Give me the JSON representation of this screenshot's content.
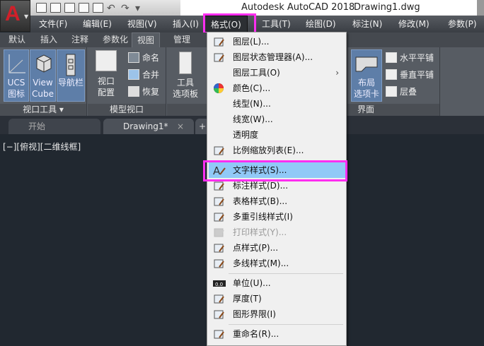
{
  "app": {
    "logo_letter": "A",
    "title": "Autodesk AutoCAD 2018",
    "document": "Drawing1.dwg"
  },
  "quick_access": [
    "new-icon",
    "open-icon",
    "save-icon",
    "save-as-icon",
    "plot-icon",
    "undo-icon",
    "redo-icon",
    "customize-icon"
  ],
  "menubar": [
    {
      "label": "文件(F)"
    },
    {
      "label": "编辑(E)"
    },
    {
      "label": "视图(V)"
    },
    {
      "label": "插入(I)"
    },
    {
      "label": "格式(O)",
      "active": true
    },
    {
      "label": "工具(T)"
    },
    {
      "label": "绘图(D)"
    },
    {
      "label": "标注(N)"
    },
    {
      "label": "修改(M)"
    },
    {
      "label": "参数(P)"
    }
  ],
  "ribbon_tabs": [
    {
      "label": "默认"
    },
    {
      "label": "插入"
    },
    {
      "label": "注释"
    },
    {
      "label": "参数化"
    },
    {
      "label": "视图",
      "active": true
    },
    {
      "label": "管理"
    }
  ],
  "ribbon": {
    "viewport_tools": {
      "label": "视口工具 ▾",
      "ucs": "UCS\n图标",
      "viewcube": "View\nCube",
      "navbar": "导航栏"
    },
    "model_viewports": {
      "label": "模型视口",
      "config": "视口\n配置",
      "named": "命名",
      "join": "合并",
      "restore": "恢复"
    },
    "palettes": {
      "tool_palettes": "工具\n选项板"
    },
    "interface": {
      "label": "界面",
      "layout_tabs": "布局\n选项卡",
      "tile_h": "水平平铺",
      "tile_v": "垂直平铺",
      "cascade": "层叠"
    }
  },
  "doc_tabs": [
    {
      "label": "开始"
    },
    {
      "label": "Drawing1*",
      "active": true,
      "close": "×"
    },
    {
      "label": "+"
    }
  ],
  "viewport_label": "[−][俯视][二维线框]",
  "format_menu": {
    "items": [
      {
        "label": "图层(L)...",
        "icon": "layer-icon"
      },
      {
        "label": "图层状态管理器(A)...",
        "icon": "layer-state-icon"
      },
      {
        "label": "图层工具(O)",
        "icon": "",
        "submenu": true
      },
      {
        "label": "颜色(C)...",
        "icon": "color-wheel-icon"
      },
      {
        "label": "线型(N)...",
        "icon": ""
      },
      {
        "label": "线宽(W)...",
        "icon": ""
      },
      {
        "label": "透明度",
        "icon": ""
      },
      {
        "label": "比例缩放列表(E)...",
        "icon": "scale-list-icon",
        "sep_after": true
      },
      {
        "label": "文字样式(S)...",
        "icon": "text-style-icon",
        "highlighted": true
      },
      {
        "label": "标注样式(D)...",
        "icon": "dim-style-icon"
      },
      {
        "label": "表格样式(B)...",
        "icon": "table-style-icon"
      },
      {
        "label": "多重引线样式(I)",
        "icon": "mleader-style-icon"
      },
      {
        "label": "打印样式(Y)...",
        "icon": "plot-style-icon",
        "disabled": true
      },
      {
        "label": "点样式(P)...",
        "icon": "point-style-icon"
      },
      {
        "label": "多线样式(M)...",
        "icon": "mline-style-icon",
        "sep_after": true
      },
      {
        "label": "单位(U)...",
        "icon": "units-icon"
      },
      {
        "label": "厚度(T)",
        "icon": "thickness-icon"
      },
      {
        "label": "图形界限(I)",
        "icon": "drawing-limits-icon",
        "sep_after": true
      },
      {
        "label": "重命名(R)...",
        "icon": "rename-icon"
      }
    ],
    "submenu_arrow": "›"
  },
  "colors": {
    "highlight_box": "#ff2ef0",
    "menu_hover": "#91c9f7",
    "canvas": "#212830",
    "logo_red": "#d0202a"
  }
}
